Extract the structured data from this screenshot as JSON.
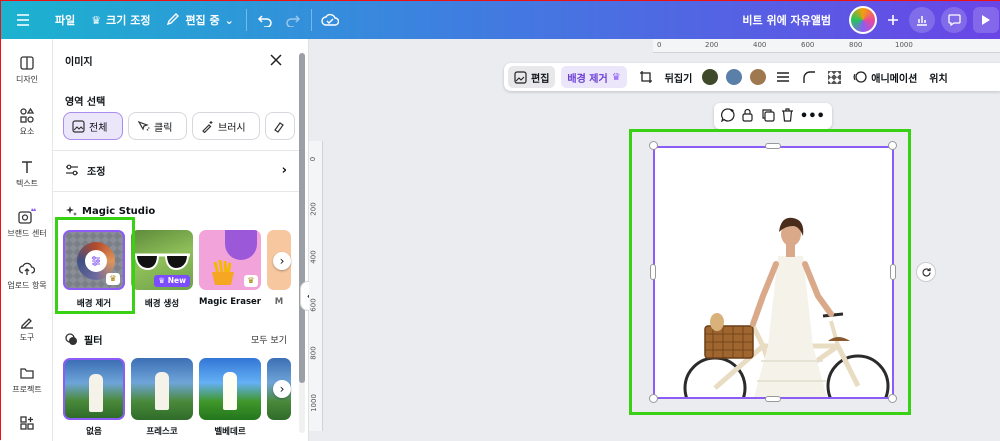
{
  "topbar": {
    "file_label": "파일",
    "resize_label": "크기 조정",
    "edit_mode_label": "편집 중",
    "project_title": "비트 위에 자유앨범"
  },
  "rail": {
    "items": [
      {
        "label": "디자인",
        "icon": "design-icon"
      },
      {
        "label": "요소",
        "icon": "elements-icon"
      },
      {
        "label": "텍스트",
        "icon": "text-icon"
      },
      {
        "label": "브랜드 센터",
        "icon": "brand-icon"
      },
      {
        "label": "업로드 항목",
        "icon": "upload-icon"
      },
      {
        "label": "도구",
        "icon": "tools-icon"
      },
      {
        "label": "프로젝트",
        "icon": "folder-icon"
      }
    ]
  },
  "panel": {
    "title": "이미지",
    "area_select": {
      "label": "영역 선택",
      "chips": [
        {
          "label": "전체",
          "active": true
        },
        {
          "label": "클릭",
          "active": false
        },
        {
          "label": "브러시",
          "active": false
        }
      ]
    },
    "adjust_label": "조정",
    "magic_studio": {
      "label": "Magic Studio",
      "cards": [
        {
          "label": "배경 제거"
        },
        {
          "label": "배경 생성",
          "badge": "New"
        },
        {
          "label": "Magic Eraser"
        },
        {
          "label": "M"
        }
      ]
    },
    "filters": {
      "label": "필터",
      "see_all": "모두 보기",
      "items": [
        {
          "label": "없음"
        },
        {
          "label": "프레스코"
        },
        {
          "label": "벨베데르"
        }
      ]
    }
  },
  "toolbar": {
    "edit_label": "편집",
    "bg_remove_label": "배경 제거",
    "flip_label": "뒤집기",
    "animate_label": "애니메이션",
    "position_label": "위치",
    "swatches": [
      "#3f4a2a",
      "#5a7fa8",
      "#a07850"
    ]
  },
  "ruler": {
    "h_ticks": [
      "0",
      "200",
      "400",
      "600",
      "800",
      "1000"
    ],
    "v_ticks": [
      "0",
      "200",
      "400",
      "600",
      "800",
      "1000"
    ]
  },
  "colors": {
    "accent": "#8b5cf6",
    "highlight": "#39d114"
  }
}
